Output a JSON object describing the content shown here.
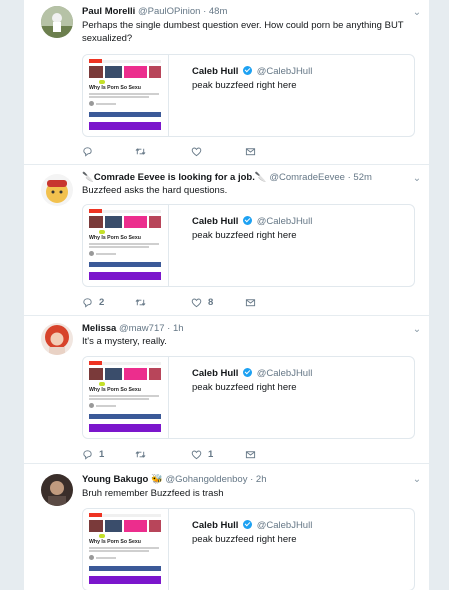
{
  "colors": {
    "page_background": "#e6ecf0",
    "link_blue": "#1da1f2",
    "muted": "#657786"
  },
  "tweets": [
    {
      "name": "Paul Morelli",
      "handle": "@PaulOPinion",
      "separator": " · ",
      "time": "48m",
      "text": "Perhaps the single dumbest question ever.  How could porn be anything BUT sexualized?",
      "quote": {
        "name": "Caleb Hull",
        "handle": "@CalebJHull",
        "text": "peak buzzfeed right here",
        "thumb_title": "Why Is Porn So Sexu"
      },
      "actions": {
        "reply_count": "",
        "retweet_count": "",
        "like_count": ""
      }
    },
    {
      "name": "🔪Comrade Eevee is looking for a job.🔪",
      "handle": "@ComradeEevee",
      "separator": " · ",
      "time": "52m",
      "text": "Buzzfeed asks the hard questions.",
      "quote": {
        "name": "Caleb Hull",
        "handle": "@CalebJHull",
        "text": "peak buzzfeed right here",
        "thumb_title": "Why Is Porn So Sexu"
      },
      "actions": {
        "reply_count": "2",
        "retweet_count": "",
        "like_count": "8"
      }
    },
    {
      "name": "Melissa",
      "handle": "@maw717",
      "separator": " · ",
      "time": "1h",
      "text": "It's a mystery, really.",
      "quote": {
        "name": "Caleb Hull",
        "handle": "@CalebJHull",
        "text": "peak buzzfeed right here",
        "thumb_title": "Why Is Porn So Sexu"
      },
      "actions": {
        "reply_count": "1",
        "retweet_count": "",
        "like_count": "1"
      }
    },
    {
      "name": "Young Bakugo",
      "emoji": "🐝",
      "handle": "@Gohangoldenboy",
      "separator": " · ",
      "time": "2h",
      "text": "Bruh remember Buzzfeed is trash",
      "quote": {
        "name": "Caleb Hull",
        "handle": "@CalebJHull",
        "text": "peak buzzfeed right here",
        "thumb_title": "Why Is Porn So Sexu"
      },
      "actions": {
        "reply_count": "",
        "retweet_count": "",
        "like_count": ""
      }
    }
  ]
}
